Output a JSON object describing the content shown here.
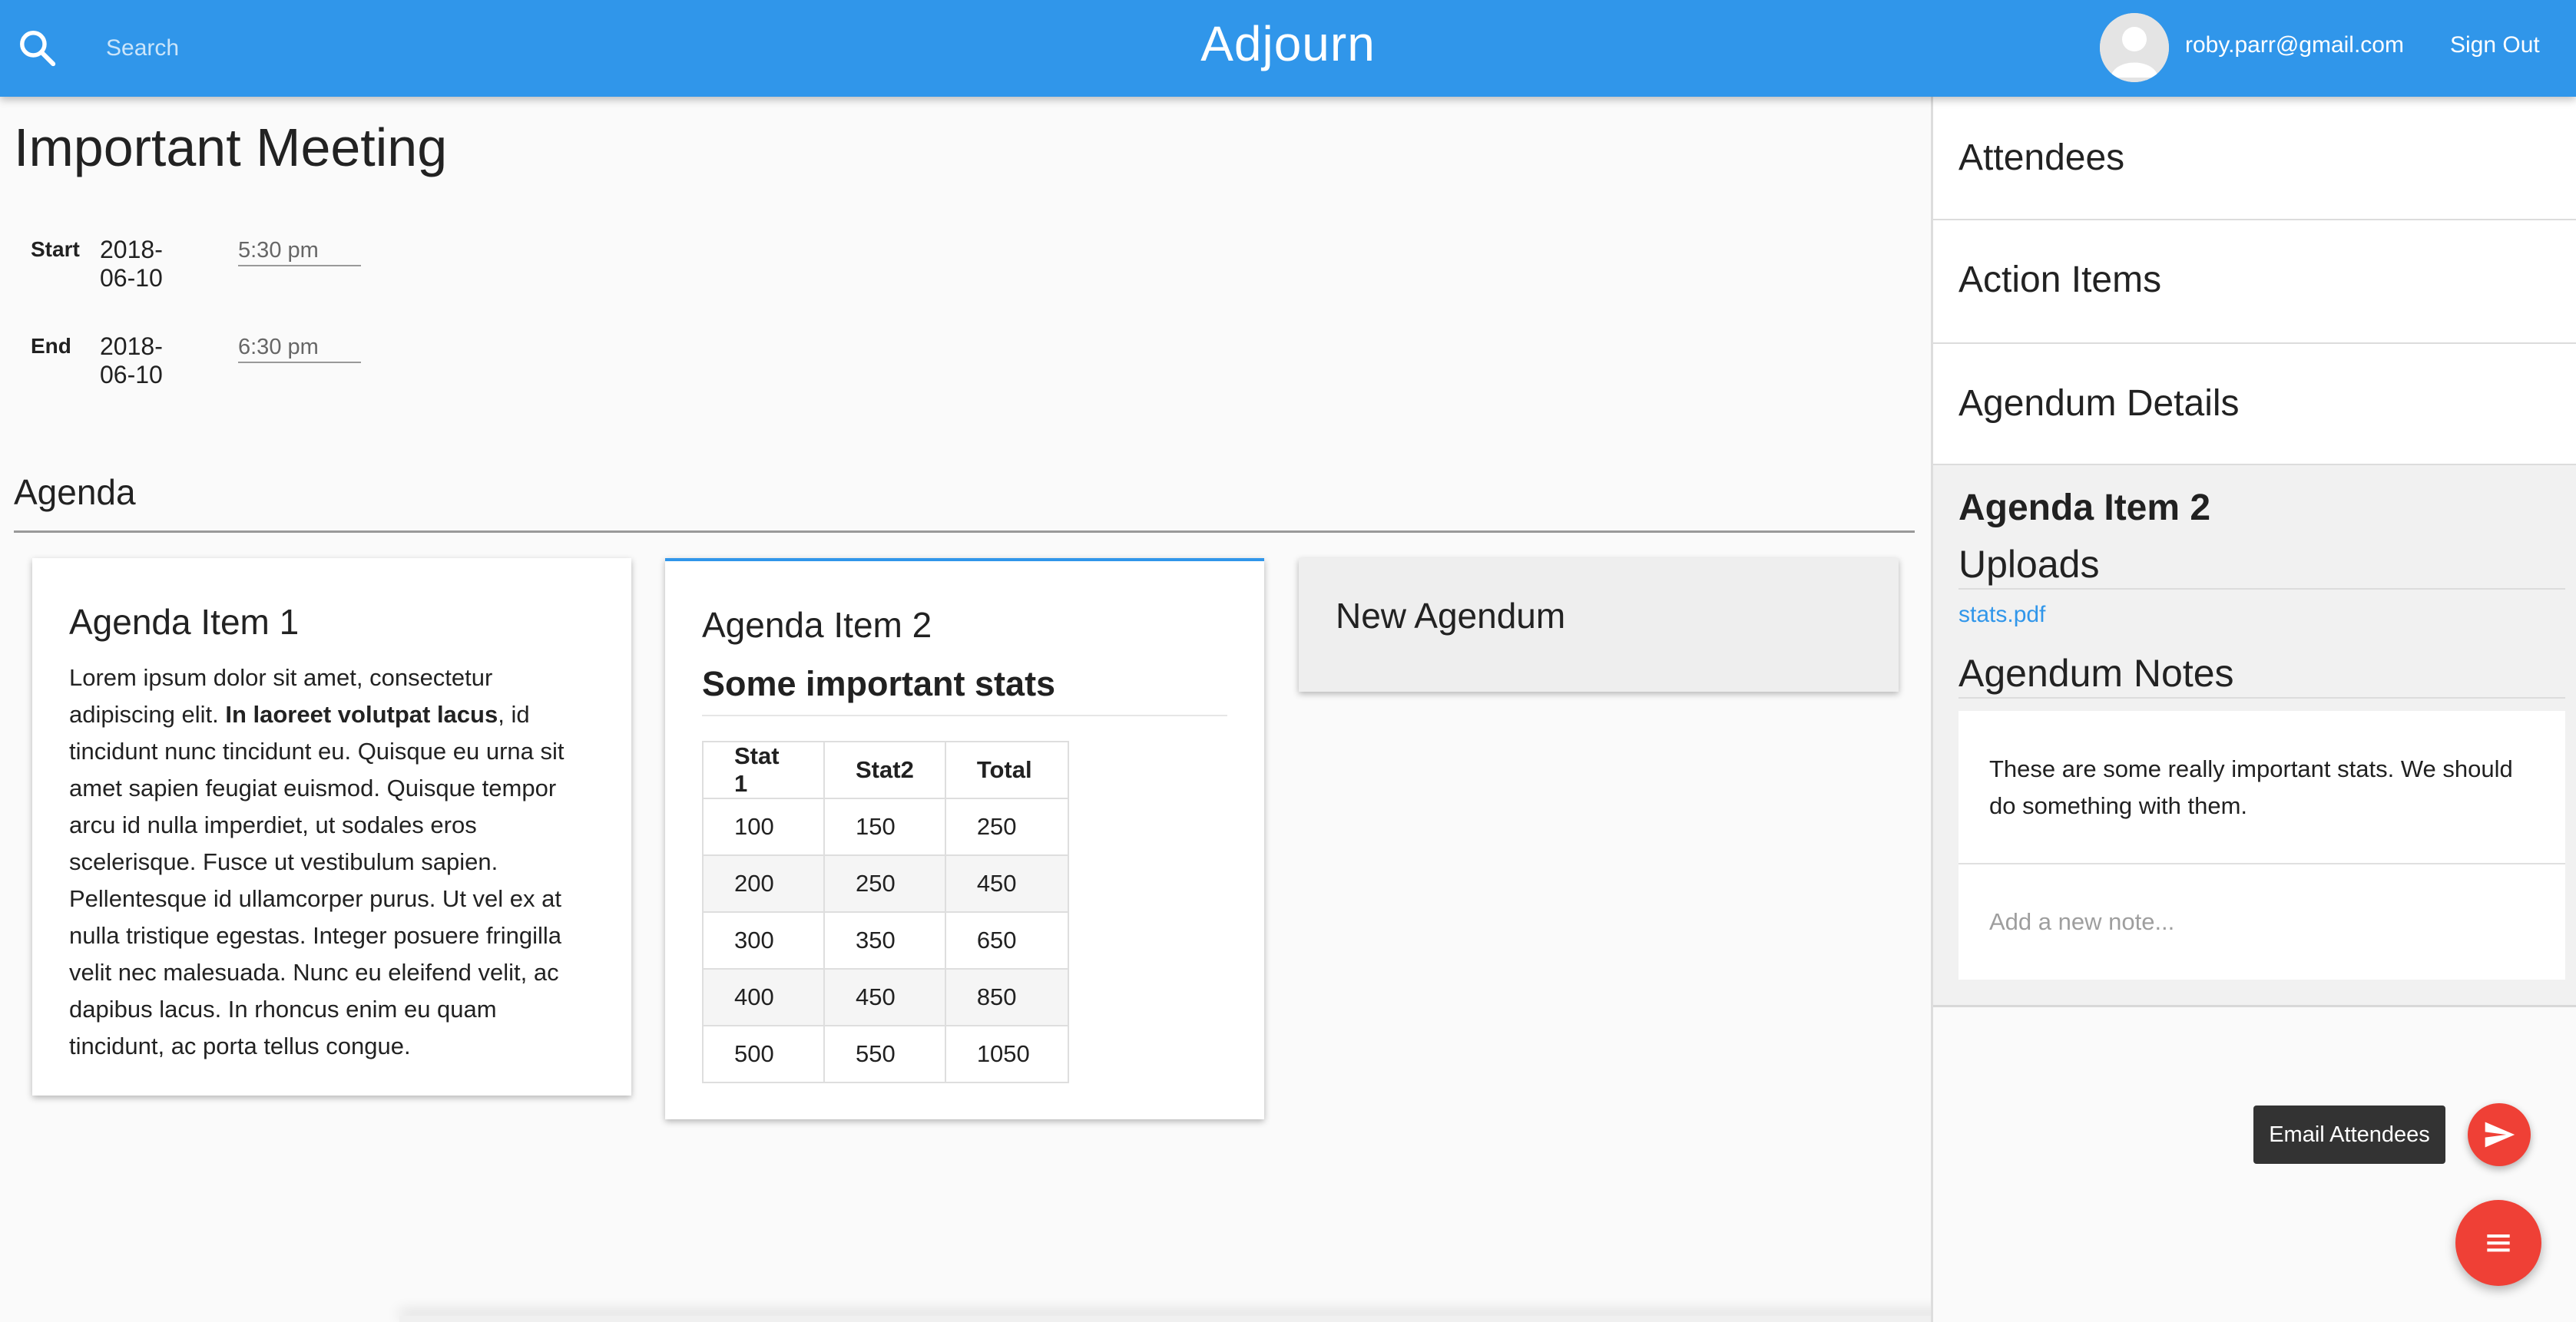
{
  "header": {
    "search_placeholder": "Search",
    "app_title": "Adjourn",
    "user_email": "roby.parr@gmail.com",
    "signout_label": "Sign Out",
    "search_icon": "search-icon",
    "avatar_icon": "default-avatar-icon"
  },
  "meeting": {
    "title": "Important Meeting",
    "start": {
      "label": "Start",
      "date": "2018-06-10",
      "time": "5:30 pm"
    },
    "end": {
      "label": "End",
      "date": "2018-06-10",
      "time": "6:30 pm"
    }
  },
  "agenda": {
    "heading": "Agenda",
    "items": [
      {
        "title": "Agenda Item 1",
        "body_start": "Lorem ipsum dolor sit amet, consectetur adipiscing elit. ",
        "body_bold": "In laoreet volutpat lacus",
        "body_end": ", id tincidunt nunc tincidunt eu. Quisque eu urna sit amet sapien feugiat euismod. Quisque tempor arcu id nulla imperdiet, ut sodales eros scelerisque. Fusce ut vestibulum sapien. Pellentesque id ullamcorper purus. Ut vel ex at nulla tristique egestas. Integer posuere fringilla velit nec malesuada. Nunc eu eleifend velit, ac dapibus lacus. In rhoncus enim eu quam tincidunt, ac porta tellus congue."
      },
      {
        "title": "Agenda Item 2",
        "subtitle": "Some important stats",
        "table": {
          "headers": [
            "Stat 1",
            "Stat2",
            "Total"
          ],
          "rows": [
            [
              "100",
              "150",
              "250"
            ],
            [
              "200",
              "250",
              "450"
            ],
            [
              "300",
              "350",
              "650"
            ],
            [
              "400",
              "450",
              "850"
            ],
            [
              "500",
              "550",
              "1050"
            ]
          ]
        }
      }
    ],
    "new_label": "New Agendum"
  },
  "sidebar": {
    "attendees": "Attendees",
    "action_items": "Action Items",
    "agendum_details": "Agendum Details",
    "selected_item": "Agenda Item 2",
    "uploads_heading": "Uploads",
    "upload_file": "stats.pdf",
    "notes_heading": "Agendum Notes",
    "note_text": "These are some really important stats. We should do something with them.",
    "note_placeholder": "Add a new note..."
  },
  "actions": {
    "email_tooltip": "Email Attendees",
    "email_icon": "send-icon",
    "menu_icon": "menu-icon"
  },
  "colors": {
    "primary": "#3096ea",
    "fab": "#ef4036",
    "tooltip": "#333333"
  }
}
